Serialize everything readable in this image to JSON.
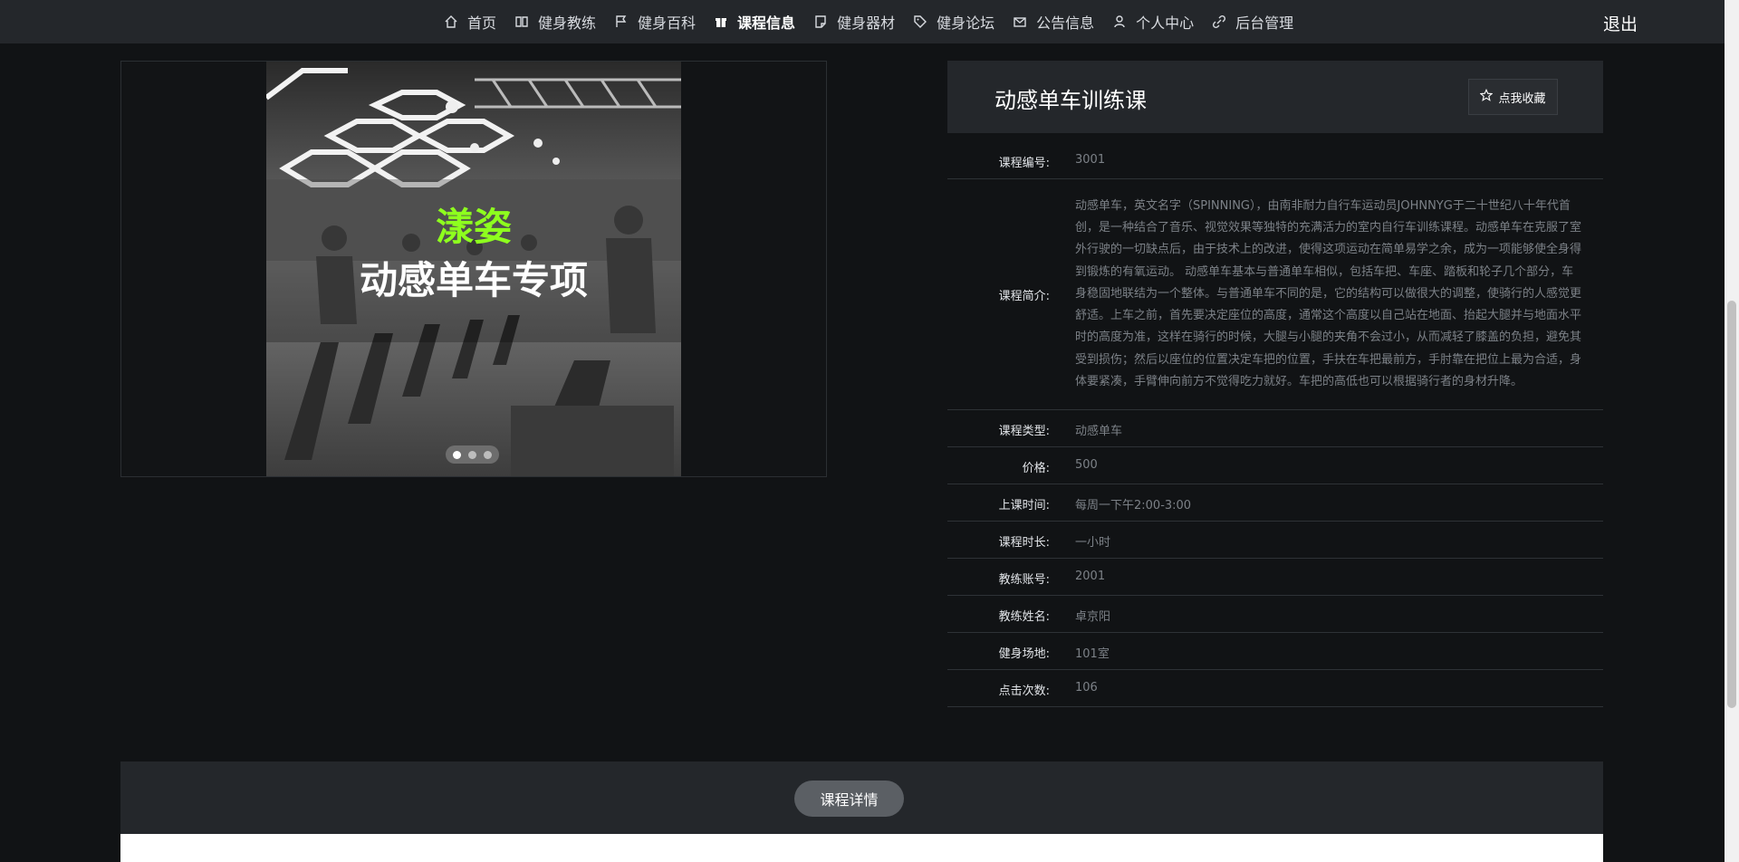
{
  "nav": {
    "items": [
      {
        "label": "首页",
        "icon": "home-icon"
      },
      {
        "label": "健身教练",
        "icon": "book-icon"
      },
      {
        "label": "健身百科",
        "icon": "flag-icon"
      },
      {
        "label": "课程信息",
        "icon": "gift-icon",
        "active": true
      },
      {
        "label": "健身器材",
        "icon": "note-icon"
      },
      {
        "label": "健身论坛",
        "icon": "tag-icon"
      },
      {
        "label": "公告信息",
        "icon": "mail-icon"
      },
      {
        "label": "个人中心",
        "icon": "user-icon"
      },
      {
        "label": "后台管理",
        "icon": "link-icon"
      }
    ],
    "logout_label": "退出"
  },
  "gallery": {
    "slide_brand": "漾姿",
    "slide_title": "动感单车专项",
    "dot_count": 3,
    "active_dot": 0
  },
  "course": {
    "title": "动感单车训练课",
    "favorite_label": "点我收藏",
    "fields": {
      "id": {
        "label": "课程编号:",
        "value": "3001"
      },
      "intro": {
        "label": "课程简介:",
        "value": "动感单车，英文名字（SPINNING），由南非耐力自行车运动员JOHNNYG于二十世纪八十年代首创，是一种结合了音乐、视觉效果等独特的充满活力的室内自行车训练课程。动感单车在克服了室外行驶的一切缺点后，由于技术上的改进，使得这项运动在简单易学之余，成为一项能够使全身得到锻炼的有氧运动。 动感单车基本与普通单车相似，包括车把、车座、踏板和轮子几个部分，车身稳固地联结为一个整体。与普通单车不同的是，它的结构可以做很大的调整，使骑行的人感觉更舒适。上车之前，首先要决定座位的高度，通常这个高度以自己站在地面、抬起大腿并与地面水平时的高度为准，这样在骑行的时候，大腿与小腿的夹角不会过小，从而减轻了膝盖的负担，避免其受到损伤；然后以座位的位置决定车把的位置，手扶在车把最前方，手肘靠在把位上最为合适，身体要紧凑，手臂伸向前方不觉得吃力就好。车把的高低也可以根据骑行者的身材升降。"
      },
      "type": {
        "label": "课程类型:",
        "value": "动感单车"
      },
      "price": {
        "label": "价格:",
        "value": "500"
      },
      "time": {
        "label": "上课时间:",
        "value": "每周一下午2:00-3:00"
      },
      "duration": {
        "label": "课程时长:",
        "value": "一小时"
      },
      "coach_account": {
        "label": "教练账号:",
        "value": "2001"
      },
      "coach_name": {
        "label": "教练姓名:",
        "value": "卓京阳"
      },
      "venue": {
        "label": "健身场地:",
        "value": "101室"
      },
      "clicks": {
        "label": "点击次数:",
        "value": "106"
      }
    }
  },
  "tabs": {
    "detail_label": "课程详情"
  },
  "colors": {
    "page_bg": "#111315",
    "bar_bg": "#24272b",
    "brand_green": "#8eff1e"
  }
}
